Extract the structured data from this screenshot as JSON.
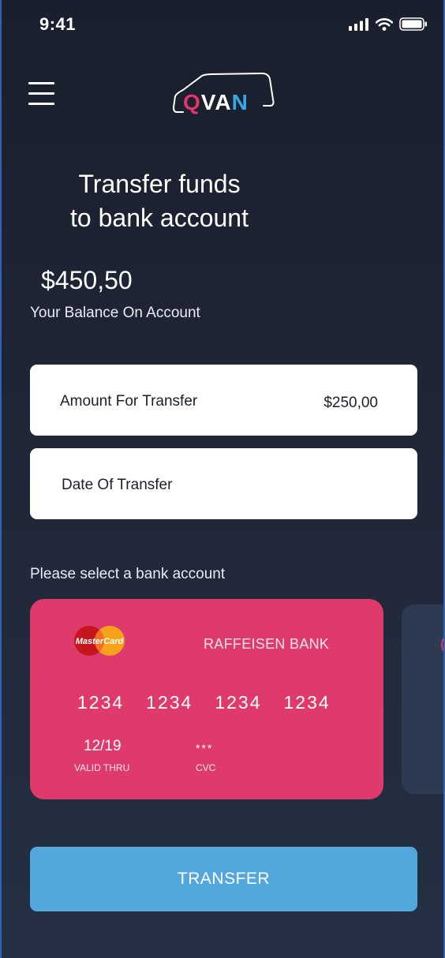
{
  "status_bar": {
    "time": "9:41"
  },
  "header": {
    "menu_icon": "hamburger-menu-icon",
    "logo": {
      "letter_q": "Q",
      "letters_va": "VA",
      "letter_n": "N",
      "colors": {
        "q": "#e3356a",
        "n": "#37a8e8"
      }
    }
  },
  "page": {
    "title_line1": "Transfer funds",
    "title_line2": "to bank account"
  },
  "balance": {
    "amount": "$450,50",
    "label": "Your Balance On Account"
  },
  "form": {
    "amount_label": "Amount For Transfer",
    "amount_value": "$250,00",
    "date_label": "Date Of Transfer",
    "date_value": ""
  },
  "bank_select": {
    "label": "Please select a bank account",
    "cards": [
      {
        "brand_icon": "mastercard-logo",
        "brand_text": "MasterCard",
        "bank": "RAFFEISEN BANK",
        "number_groups": [
          "1234",
          "1234",
          "1234",
          "1234"
        ],
        "expiry": "12/19",
        "expiry_label": "VALID THRU",
        "cvc": "***",
        "cvc_label": "CVC",
        "color": "#df3a6c"
      }
    ]
  },
  "actions": {
    "transfer_label": "TRANSFER",
    "transfer_color": "#52a8dc"
  }
}
